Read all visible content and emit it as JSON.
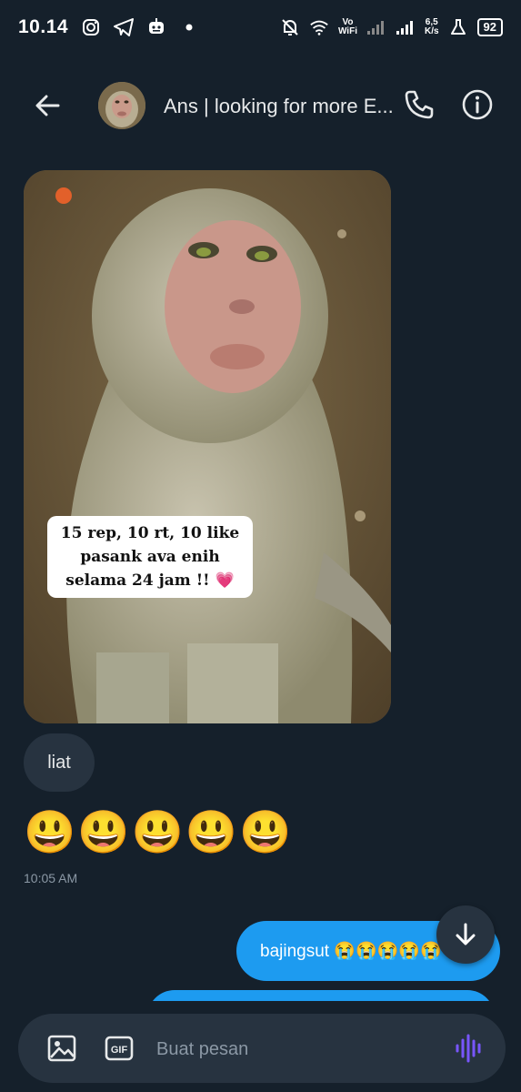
{
  "status_bar": {
    "time": "10.14",
    "net_label_top": "Vo",
    "net_label_bottom": "WiFi",
    "speed_top": "6,5",
    "speed_bottom": "K/s",
    "battery": "92"
  },
  "header": {
    "title": "Ans | looking for more E..."
  },
  "thread": {
    "image_caption_line1": "15 rep, 10 rt, 10 like",
    "image_caption_line2": "pasank ava enih",
    "image_caption_line3": "selama 24 jam !! 💗",
    "received_text": "liat",
    "emoji_message": "😃😃😃😃😃",
    "timestamp": "10:05 AM",
    "sent_text": "bajingsut 😭😭😭😭😭"
  },
  "composer": {
    "placeholder": "Buat pesan"
  },
  "colors": {
    "background": "#15202b",
    "bubble_received": "#273340",
    "bubble_sent": "#1d9bf0",
    "voice_accent": "#7856ff"
  },
  "icons": [
    "back-arrow-icon",
    "phone-icon",
    "info-icon",
    "image-icon",
    "gif-icon",
    "voice-wave-icon",
    "arrow-down-icon"
  ]
}
